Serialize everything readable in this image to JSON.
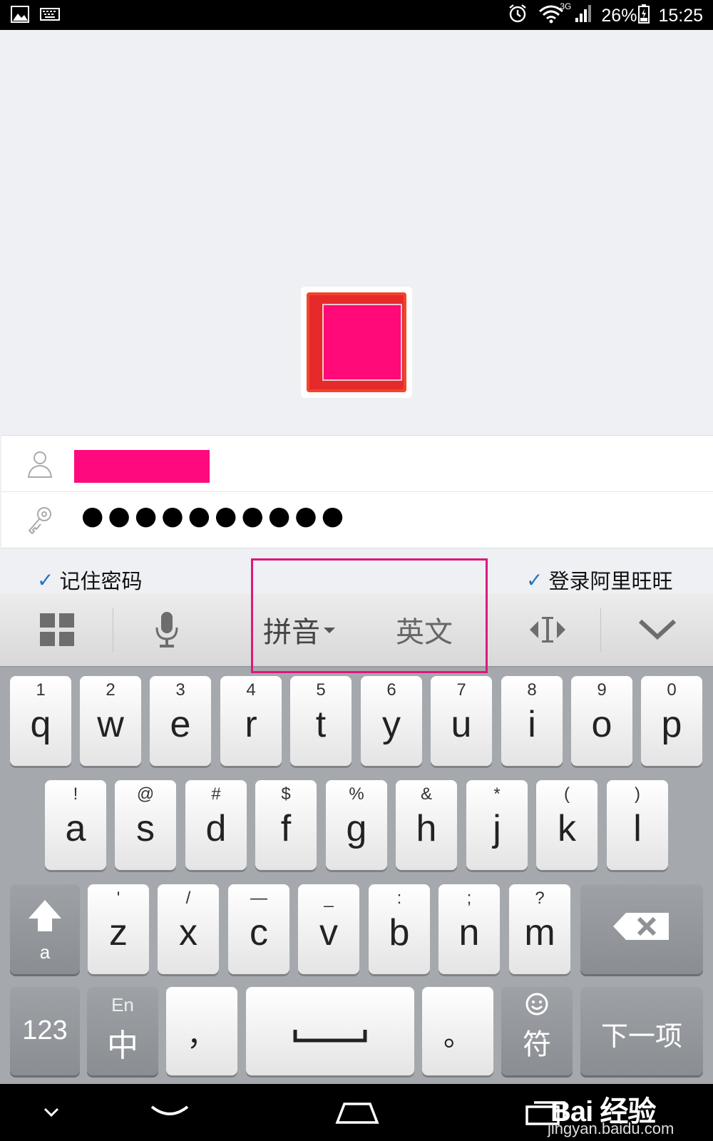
{
  "status_bar": {
    "time": "15:25",
    "battery": "26%",
    "network": "3G",
    "left_icons": [
      "image-icon",
      "keyboard-icon"
    ],
    "right_icons": [
      "alarm-icon",
      "wifi-icon",
      "signal-icon",
      "battery-charging-icon"
    ]
  },
  "login": {
    "logo_icon": "app-logo-icon",
    "username_value": "",
    "password_masked": "●●●●●●●●●●",
    "remember_password": {
      "label": "记住密码",
      "checked": true
    },
    "auto_login": {
      "label": "登录阿里旺旺",
      "checked": true
    }
  },
  "keyboard": {
    "toolbar": {
      "grid_icon": "grid-menu-icon",
      "mic_icon": "microphone-icon",
      "pinyin_label": "拼音",
      "english_label": "英文",
      "cursor_icon": "cursor-move-icon",
      "hide_icon": "chevron-down-icon"
    },
    "row1": [
      {
        "main": "q",
        "hint": "1"
      },
      {
        "main": "w",
        "hint": "2"
      },
      {
        "main": "e",
        "hint": "3"
      },
      {
        "main": "r",
        "hint": "4"
      },
      {
        "main": "t",
        "hint": "5"
      },
      {
        "main": "y",
        "hint": "6"
      },
      {
        "main": "u",
        "hint": "7"
      },
      {
        "main": "i",
        "hint": "8"
      },
      {
        "main": "o",
        "hint": "9"
      },
      {
        "main": "p",
        "hint": "0"
      }
    ],
    "row2": [
      {
        "main": "a",
        "hint": "!"
      },
      {
        "main": "s",
        "hint": "@"
      },
      {
        "main": "d",
        "hint": "#"
      },
      {
        "main": "f",
        "hint": "$"
      },
      {
        "main": "g",
        "hint": "%"
      },
      {
        "main": "h",
        "hint": "&"
      },
      {
        "main": "j",
        "hint": "*"
      },
      {
        "main": "k",
        "hint": "("
      },
      {
        "main": "l",
        "hint": ")"
      }
    ],
    "row3": [
      {
        "main": "z",
        "hint": "'"
      },
      {
        "main": "x",
        "hint": "/"
      },
      {
        "main": "c",
        "hint": "—"
      },
      {
        "main": "v",
        "hint": "_"
      },
      {
        "main": "b",
        "hint": ":"
      },
      {
        "main": "n",
        "hint": ";"
      },
      {
        "main": "m",
        "hint": "?"
      }
    ],
    "shift_label": "a",
    "numbers_label": "123",
    "lang_top": "En",
    "lang_main": "中",
    "comma_label": "，",
    "period_label": "。",
    "symbols_label": "符",
    "next_label": "下一项"
  },
  "navbar": {
    "icons": [
      "hide-keyboard-icon",
      "back-icon",
      "home-icon",
      "recent-apps-icon"
    ]
  },
  "watermark": {
    "logo": "Bai 经验",
    "url": "jingyan.baidu.com"
  },
  "colors": {
    "accent": "#e0167e",
    "check": "#2a72c2"
  }
}
